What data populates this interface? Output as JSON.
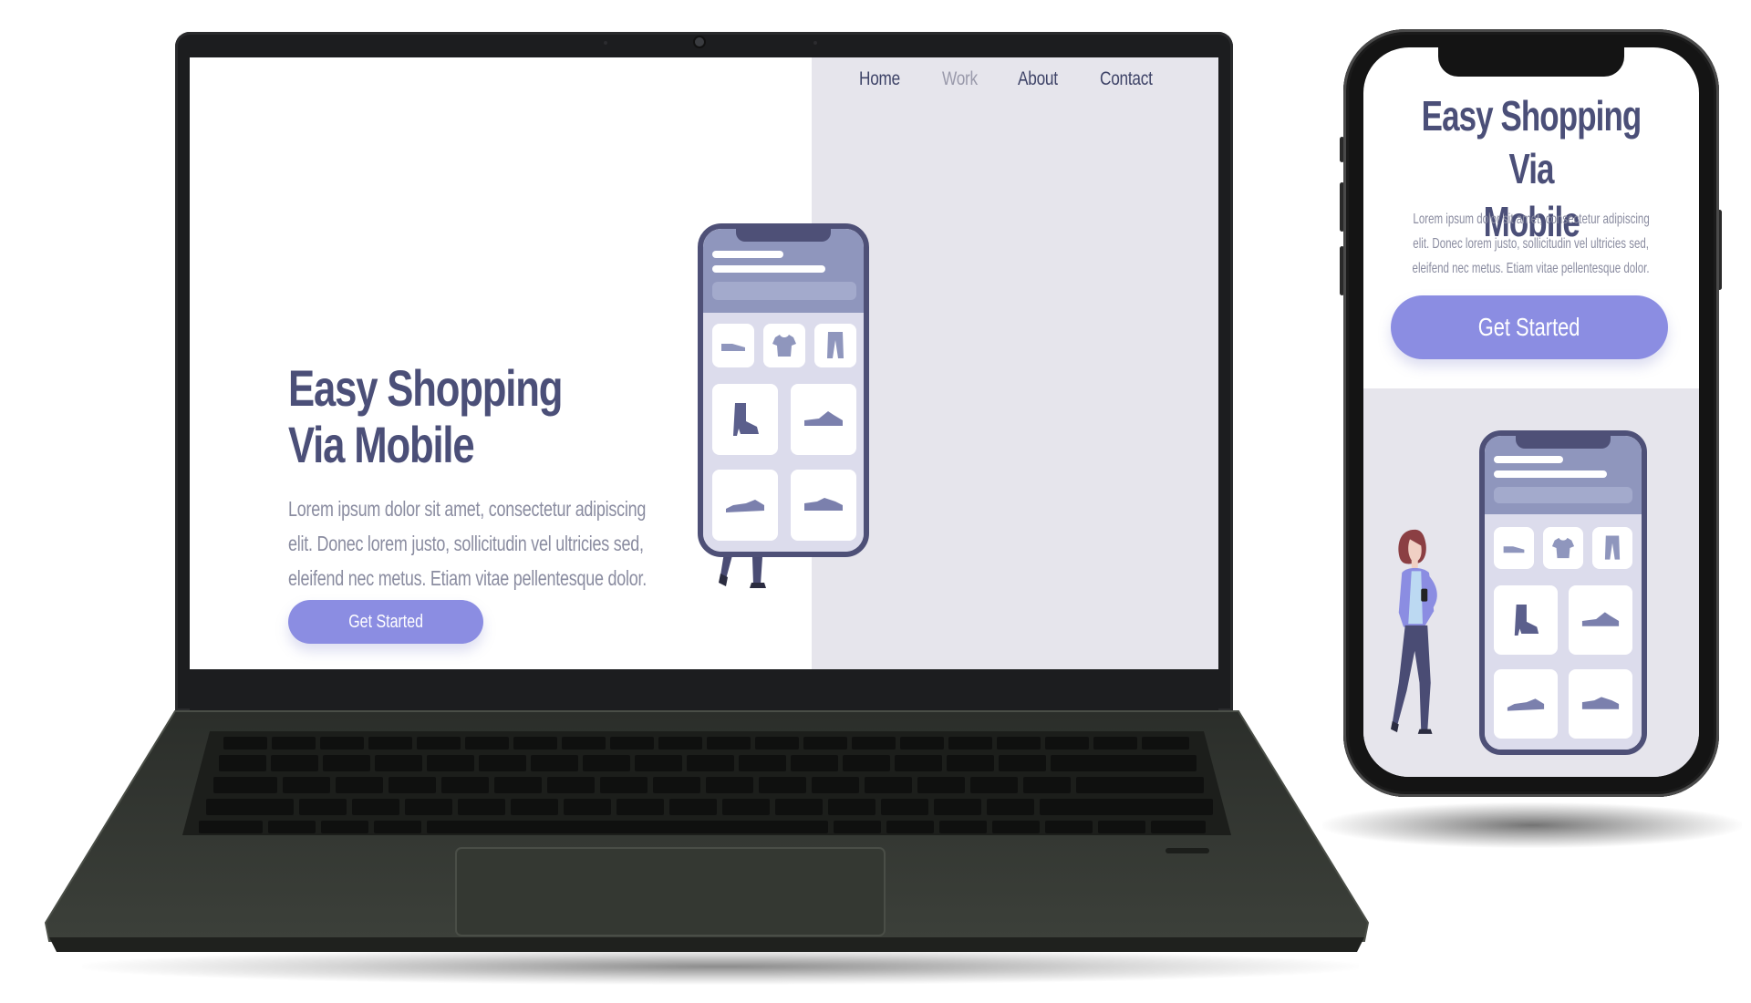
{
  "laptop_site": {
    "nav": [
      {
        "label": "Home"
      },
      {
        "label": "Work"
      },
      {
        "label": "About"
      },
      {
        "label": "Contact"
      }
    ],
    "hero": {
      "title_line1": "Easy Shopping",
      "title_line2": "Via Mobile",
      "text_line1": "Lorem ipsum dolor sit amet, consectetur adipiscing",
      "text_line2": "elit. Donec lorem justo, sollicitudin vel ultricies sed,",
      "text_line3": "eleifend nec metus. Etiam vitae pellentesque dolor.",
      "cta": "Get Started"
    }
  },
  "mobile_site": {
    "hero": {
      "title_line1": "Easy Shopping Via",
      "title_line2": "Mobile",
      "text_line1": "Lorem ipsum dolor sit amet, consectetur adipiscing",
      "text_line2": "elit. Donec lorem justo, sollicitudin vel ultricies sed,",
      "text_line3": "eleifend nec metus. Etiam vitae pellentesque dolor.",
      "cta": "Get Started"
    }
  },
  "illustration_icons": [
    "flat-shoe-icon",
    "t-shirt-icon",
    "pants-icon",
    "boot-icon",
    "sneaker-icon",
    "sneaker-icon",
    "sneaker-icon"
  ],
  "colors": {
    "accent": "#8b8de2",
    "heading": "#4b4f78",
    "body_text": "#8a8ca0",
    "panel_bg": "#e6e5ec",
    "device_frame": "#4e5077"
  }
}
